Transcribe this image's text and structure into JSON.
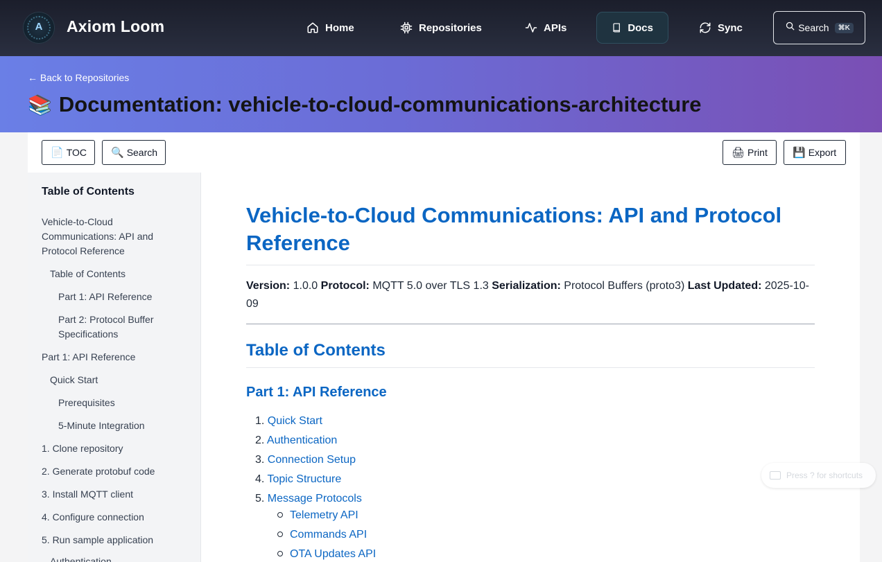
{
  "nav": {
    "brand": "Axiom Loom",
    "logo_letter": "A",
    "items": [
      {
        "label": "Home",
        "icon": "home-icon"
      },
      {
        "label": "Repositories",
        "icon": "chip-icon"
      },
      {
        "label": "APIs",
        "icon": "activity-icon"
      },
      {
        "label": "Docs",
        "icon": "book-icon",
        "active": true
      },
      {
        "label": "Sync",
        "icon": "refresh-icon"
      }
    ],
    "search_label": "Search",
    "search_shortcut": "⌘K"
  },
  "hero": {
    "back_link": "← Back to Repositories",
    "title": "Documentation: vehicle-to-cloud-communications-architecture",
    "title_icon": "📚"
  },
  "toolbar": {
    "toc_label": "TOC",
    "search_label": "Search",
    "print_label": "Print",
    "export_label": "Export"
  },
  "sidebar": {
    "heading": "Table of Contents",
    "items": [
      {
        "label": "Vehicle-to-Cloud Communications: API and Protocol Reference",
        "level": 0
      },
      {
        "label": "Table of Contents",
        "level": 1
      },
      {
        "label": "Part 1: API Reference",
        "level": 2
      },
      {
        "label": "Part 2: Protocol Buffer Specifications",
        "level": 2
      },
      {
        "label": "Part 1: API Reference",
        "level": 0
      },
      {
        "label": "Quick Start",
        "level": 1
      },
      {
        "label": "Prerequisites",
        "level": 2
      },
      {
        "label": "5-Minute Integration",
        "level": 2
      },
      {
        "label": "1. Clone repository",
        "level": 0
      },
      {
        "label": "2. Generate protobuf code",
        "level": 0
      },
      {
        "label": "3. Install MQTT client",
        "level": 0
      },
      {
        "label": "4. Configure connection",
        "level": 0
      },
      {
        "label": "5. Run sample application",
        "level": 0
      },
      {
        "label": "Authentication",
        "level": 1
      }
    ]
  },
  "doc": {
    "title": "Vehicle-to-Cloud Communications: API and Protocol Reference",
    "meta": {
      "version_label": "Version:",
      "version": "1.0.0",
      "protocol_label": "Protocol:",
      "protocol": "MQTT 5.0 over TLS 1.3",
      "serialization_label": "Serialization:",
      "serialization": "Protocol Buffers (proto3)",
      "updated_label": "Last Updated:",
      "updated": "2025-10-09"
    },
    "toc_heading": "Table of Contents",
    "part1_heading": "Part 1: API Reference",
    "list": [
      {
        "num": "1.",
        "label": "Quick Start"
      },
      {
        "num": "2.",
        "label": "Authentication"
      },
      {
        "num": "3.",
        "label": "Connection Setup"
      },
      {
        "num": "4.",
        "label": "Topic Structure"
      },
      {
        "num": "5.",
        "label": "Message Protocols"
      }
    ],
    "sublist": [
      "Telemetry API",
      "Commands API",
      "OTA Updates API"
    ]
  },
  "hint": {
    "label": "Press ? for shortcuts"
  }
}
